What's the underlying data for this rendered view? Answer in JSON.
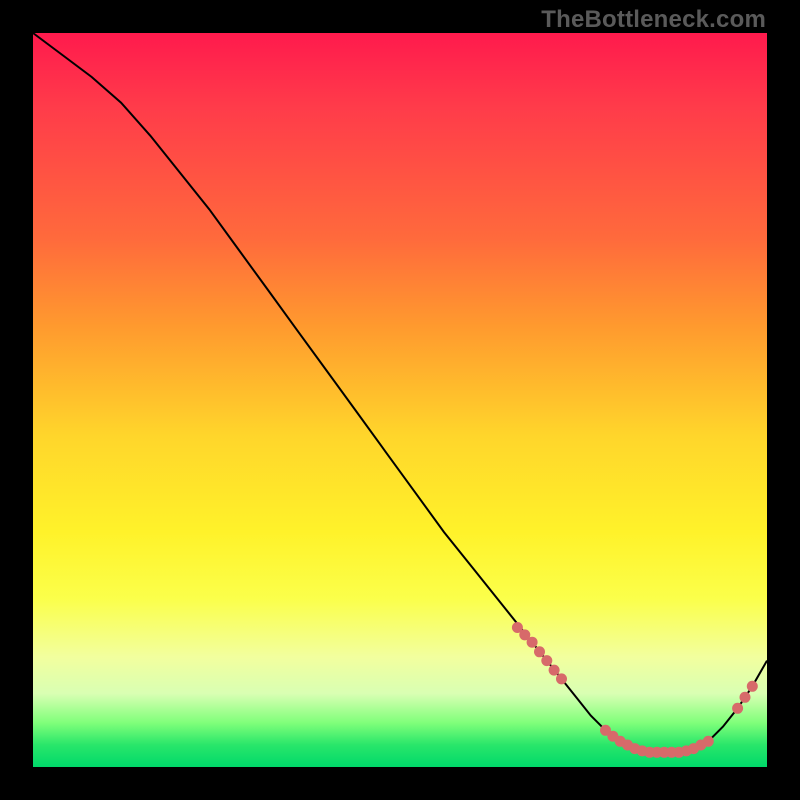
{
  "watermark": "TheBottleneck.com",
  "colors": {
    "marker": "#d76a6a",
    "line": "#000000",
    "gradient_top": "#ff1a4d",
    "gradient_bottom": "#00d96a"
  },
  "chart_data": {
    "type": "line",
    "title": "",
    "xlabel": "",
    "ylabel": "",
    "xlim": [
      0,
      100
    ],
    "ylim": [
      0,
      100
    ],
    "grid": false,
    "legend": false,
    "series": [
      {
        "name": "curve",
        "x": [
          0,
          4,
          8,
          12,
          16,
          20,
          24,
          28,
          32,
          36,
          40,
          44,
          48,
          52,
          56,
          60,
          64,
          68,
          70,
          72,
          74,
          76,
          78,
          80,
          82,
          84,
          86,
          88,
          90,
          92,
          94,
          96,
          98,
          100
        ],
        "y": [
          100,
          97,
          94,
          90.5,
          86,
          81,
          76,
          70.5,
          65,
          59.5,
          54,
          48.5,
          43,
          37.5,
          32,
          27,
          22,
          17,
          14.5,
          12,
          9.5,
          7,
          5,
          3.5,
          2.5,
          2,
          2,
          2,
          2.5,
          3.5,
          5.5,
          8,
          11,
          14.5
        ]
      }
    ],
    "markers": {
      "name": "highlight-points",
      "x": [
        66,
        67,
        68,
        69,
        70,
        71,
        72,
        78,
        79,
        80,
        81,
        82,
        83,
        84,
        85,
        86,
        87,
        88,
        89,
        90,
        91,
        92,
        96,
        97,
        98
      ],
      "y": [
        19,
        18,
        17,
        15.7,
        14.5,
        13.2,
        12,
        5,
        4.2,
        3.5,
        3,
        2.5,
        2.2,
        2,
        2,
        2,
        2,
        2,
        2.2,
        2.5,
        3,
        3.5,
        8,
        9.5,
        11
      ]
    }
  }
}
